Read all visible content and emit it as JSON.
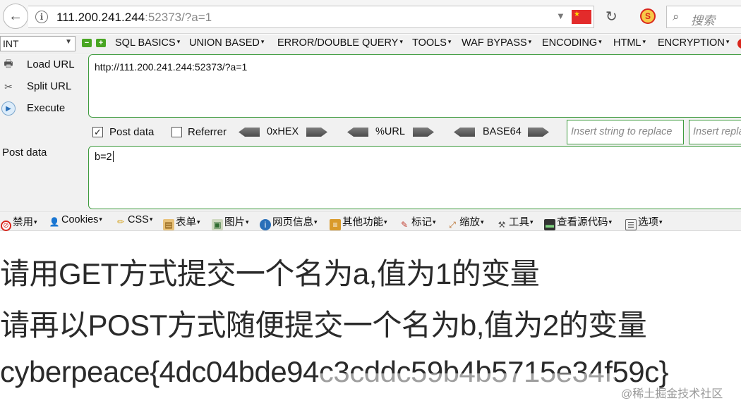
{
  "address_bar": {
    "url_host": "111.200.241.244",
    "url_rest": ":52373/?a=1",
    "search_placeholder": "搜索"
  },
  "hackbar": {
    "select_value": "INT",
    "menu": [
      "SQL BASICS",
      "UNION BASED",
      "ERROR/DOUBLE QUERY",
      "TOOLS",
      "WAF BYPASS",
      "ENCODING",
      "HTML",
      "ENCRYPTION"
    ],
    "actions": {
      "load": "Load URL",
      "split": "Split URL",
      "execute": "Execute"
    },
    "url_value": "http://111.200.241.244:52373/?a=1",
    "post_data_checkbox": "Post data",
    "referrer_checkbox": "Referrer",
    "encoders": [
      "0xHEX",
      "%URL",
      "BASE64"
    ],
    "replace_placeholder": "Insert string to replace",
    "replace_with_placeholder": "Insert replacing string",
    "post_label": "Post data",
    "post_value": "b=2"
  },
  "toolbar2": [
    "禁用",
    "Cookies",
    "CSS",
    "表单",
    "图片",
    "网页信息",
    "其他功能",
    "标记",
    "缩放",
    "工具",
    "查看源代码",
    "选项"
  ],
  "content": {
    "line1": "请用GET方式提交一个名为a,值为1的变量",
    "line2": "请再以POST方式随便提交一个名为b,值为2的变量",
    "line3": "cyberpeace{4dc04bde94c3cddc59b4b5715e34f59c}"
  },
  "watermark": "@稀土掘金技术社区",
  "colors": {
    "accent_green": "#3e9b3e",
    "text": "#2a2a2a"
  }
}
